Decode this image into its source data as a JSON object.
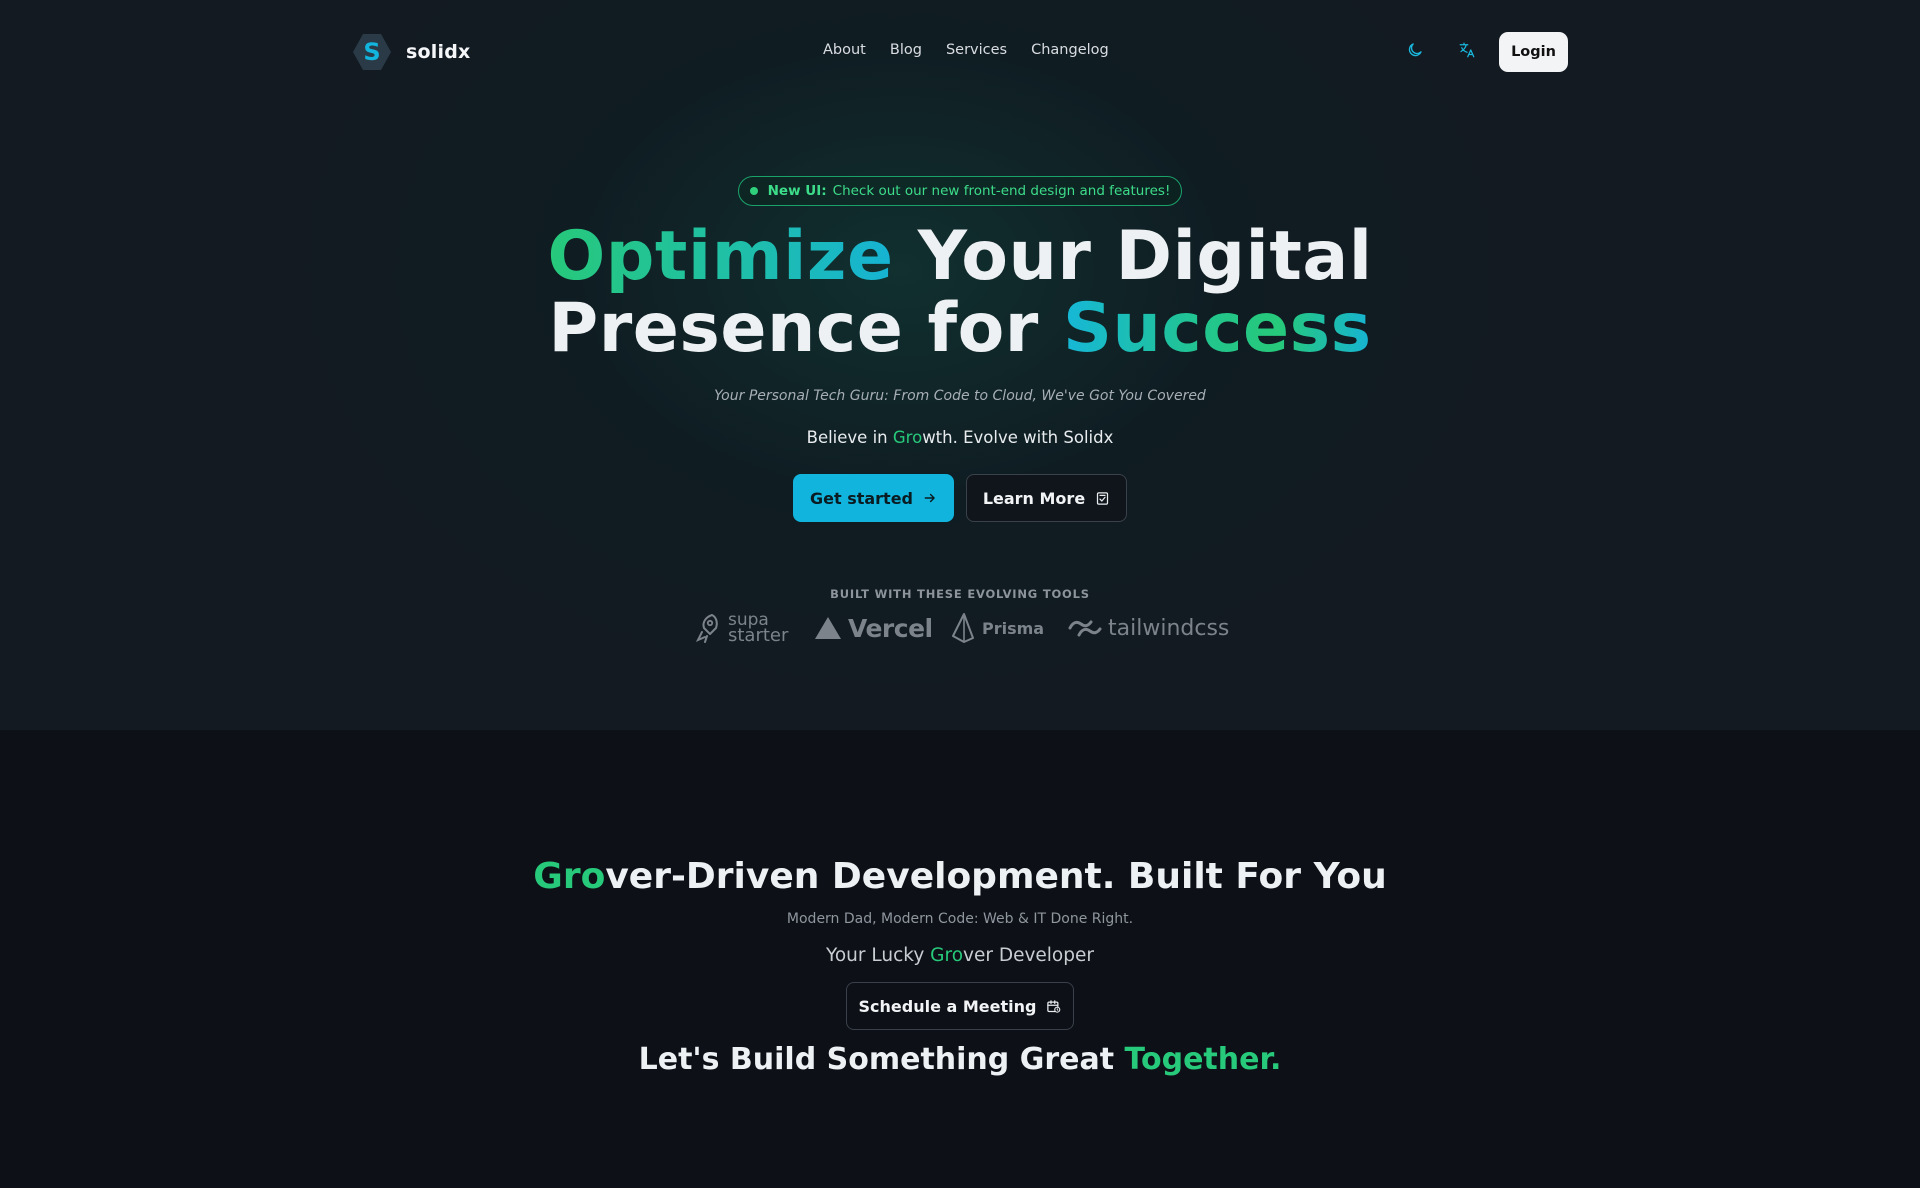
{
  "header": {
    "brand": "solidx",
    "nav": [
      "About",
      "Blog",
      "Services",
      "Changelog"
    ],
    "theme_icon": "moon-icon",
    "language_icon": "translate-icon",
    "login_label": "Login"
  },
  "hero": {
    "badge_strong": "New UI:",
    "badge_text": "Check out our new front-end design and features!",
    "headline_line1_accent": "Optimize",
    "headline_line1_rest": " Your Digital",
    "headline_line2_start": "Presence for ",
    "headline_line2_accent": "Success",
    "tagline": "Your Personal Tech Guru: From Code to Cloud, We've Got You Covered",
    "believe_prefix": "Believe in ",
    "believe_accent": "Gro",
    "believe_suffix": "wth. Evolve with Solidx",
    "primary_button": "Get started",
    "secondary_button": "Learn More",
    "built_with": "BUILT WITH THESE EVOLVING TOOLS",
    "tools": [
      {
        "name": "supastarter",
        "line1": "supa",
        "line2": "starter"
      },
      {
        "name": "Vercel",
        "label": "Vercel"
      },
      {
        "name": "Prisma",
        "label": "Prisma"
      },
      {
        "name": "tailwindcss",
        "label": "tailwindcss"
      }
    ]
  },
  "section": {
    "title_accent": "Gro",
    "title_rest": "ver-Driven Development. Built For You",
    "subtitle": "Modern Dad, Modern Code: Web & IT Done Right.",
    "lucky_prefix": "Your Lucky ",
    "lucky_accent": "Gro",
    "lucky_suffix": "ver Developer",
    "meeting_button": "Schedule a Meeting",
    "cta_text": "Let's Build Something Great ",
    "cta_accent": "Together."
  },
  "colors": {
    "accent_green": "#27c97a",
    "accent_cyan": "#10b4dc",
    "background": "#0d1117"
  }
}
